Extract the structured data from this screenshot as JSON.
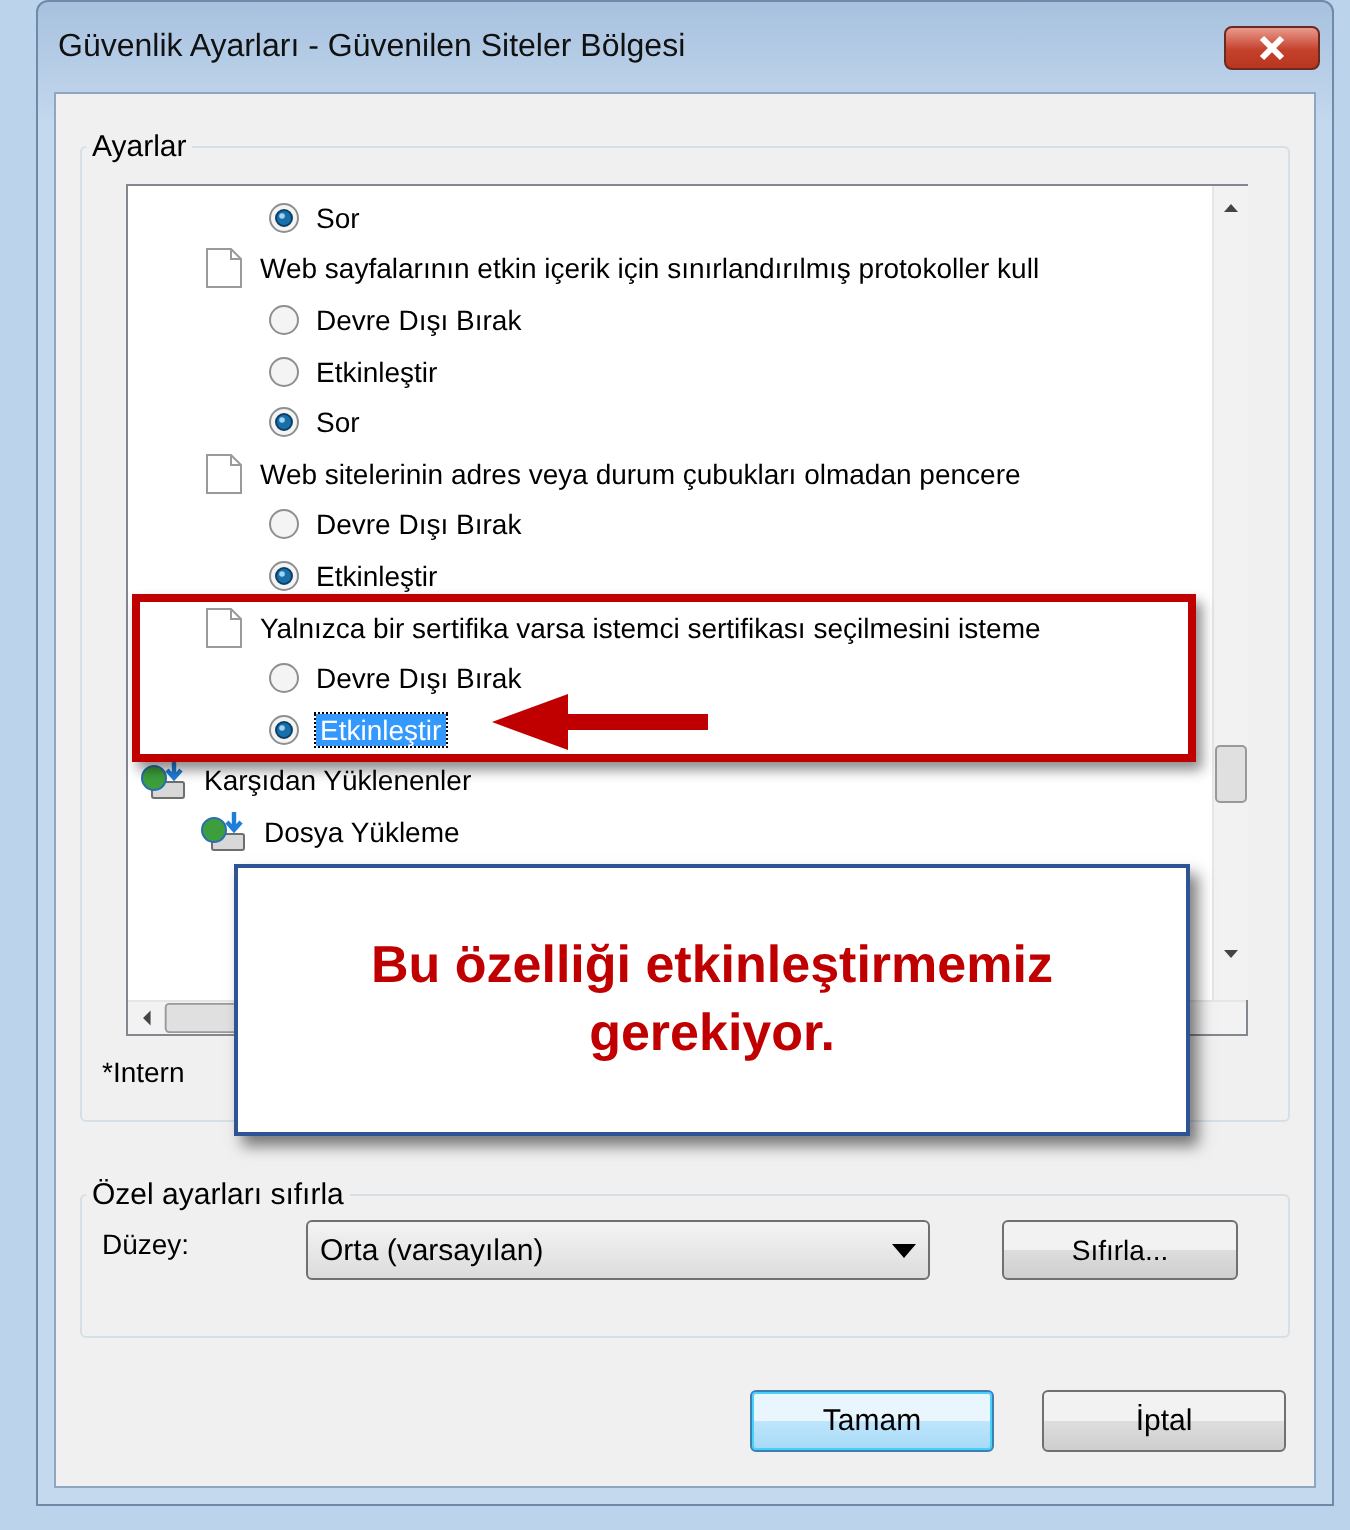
{
  "window": {
    "title": "Güvenlik Ayarları - Güvenilen Siteler Bölgesi"
  },
  "settings_group": {
    "title": "Ayarlar",
    "items": [
      {
        "kind": "option",
        "label": "Sor",
        "selected": true,
        "focused": false
      },
      {
        "kind": "setting",
        "label": "Web sayfalarının etkin içerik için sınırlandırılmış protokoller kull",
        "children": [
          {
            "kind": "option",
            "label": "Devre Dışı Bırak",
            "selected": false,
            "focused": false
          },
          {
            "kind": "option",
            "label": "Etkinleştir",
            "selected": false,
            "focused": false
          },
          {
            "kind": "option",
            "label": "Sor",
            "selected": true,
            "focused": false
          }
        ]
      },
      {
        "kind": "setting",
        "label": "Web sitelerinin adres veya durum çubukları olmadan pencere",
        "children": [
          {
            "kind": "option",
            "label": "Devre Dışı Bırak",
            "selected": false,
            "focused": false
          },
          {
            "kind": "option",
            "label": "Etkinleştir",
            "selected": true,
            "focused": false
          }
        ]
      },
      {
        "kind": "setting",
        "label": "Yalnızca bir sertifika varsa istemci sertifikası seçilmesini isteme",
        "children": [
          {
            "kind": "option",
            "label": "Devre Dışı Bırak",
            "selected": false,
            "focused": false
          },
          {
            "kind": "option",
            "label": "Etkinleştir",
            "selected": true,
            "focused": true
          }
        ]
      },
      {
        "kind": "category",
        "label": "Karşıdan Yüklenenler",
        "children": [
          {
            "kind": "category",
            "label": "Dosya Yükleme"
          }
        ]
      }
    ],
    "note": "*Intern"
  },
  "callout": {
    "text": "Bu özelliği etkinleştirmemiz gerekiyor."
  },
  "reset_group": {
    "title": "Özel ayarları sıfırla",
    "level_label": "Düzey:",
    "level_value": "Orta (varsayılan)",
    "reset_button": "Sıfırla..."
  },
  "buttons": [
    {
      "label": "Tamam",
      "default": true
    },
    {
      "label": "İptal",
      "default": false
    }
  ]
}
